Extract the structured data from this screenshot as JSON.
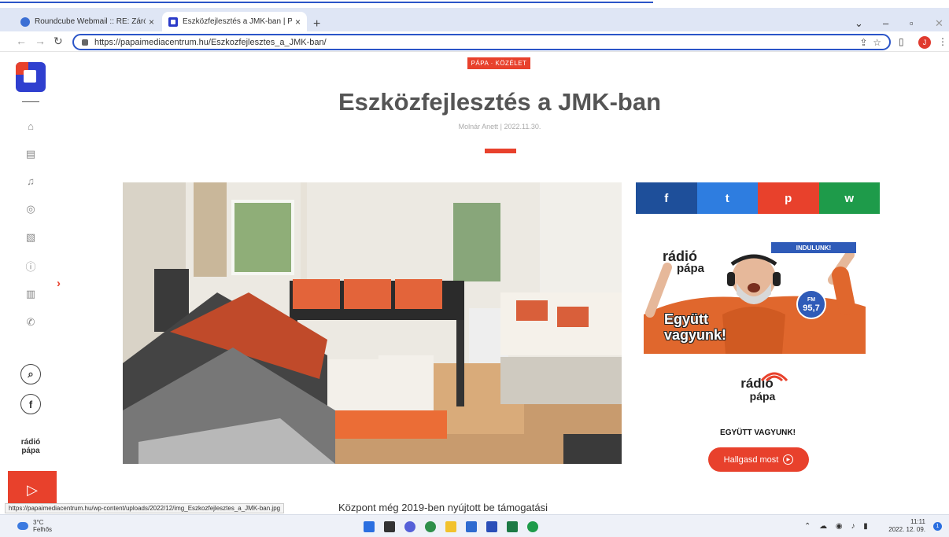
{
  "browser": {
    "tabs": [
      {
        "title": "Roundcube Webmail :: RE: Záró",
        "active": false
      },
      {
        "title": "Eszközfejlesztés a JMK-ban | Pá",
        "active": true
      }
    ],
    "new_tab": "+",
    "close_glyph": "×",
    "url": "https://papaimediacentrum.hu/Eszkozfejlesztes_a_JMK-ban/",
    "profile_initial": "J"
  },
  "sidebar": {
    "radio_label": "rádió pápa",
    "play_glyph": "▷"
  },
  "article": {
    "category": "PÁPA · KÖZÉLET",
    "title": "Eszközfejlesztés a JMK-ban",
    "byline": "Molnár Anett | 2022.11.30.",
    "body_snippet": "Központ még 2019-ben nyújtott be támogatási"
  },
  "status_bar_url": "https://papaimediacentrum.hu/wp-content/uploads/2022/12/img_Eszkozfejlesztes_a_JMK-ban.jpg",
  "share": {
    "facebook": "f",
    "twitter": "t",
    "pinterest": "p",
    "whatsapp": "w"
  },
  "ad": {
    "badge": "INDULUNK!",
    "logo_top": "rádió",
    "logo_bottom": "pápa",
    "fm_label": "FM",
    "fm_value": "95,7",
    "slogan_line1": "Együtt",
    "slogan_line2": "vagyunk!"
  },
  "radio_widget": {
    "logo_top": "rádió",
    "logo_bottom": "pápa",
    "slogan": "EGYÜTT VAGYUNK!",
    "listen_label": "Hallgasd most"
  },
  "taskbar": {
    "temp": "3°C",
    "condition": "Felhős",
    "time": "11:11",
    "date": "2022. 12. 09.",
    "notification_count": "1"
  },
  "colors": {
    "accent": "#e8412c",
    "brand_blue": "#2f3fcf",
    "facebook": "#1e4f9a",
    "twitter": "#2e7de0",
    "pinterest": "#e8412c",
    "whatsapp": "#1e9b4a"
  }
}
